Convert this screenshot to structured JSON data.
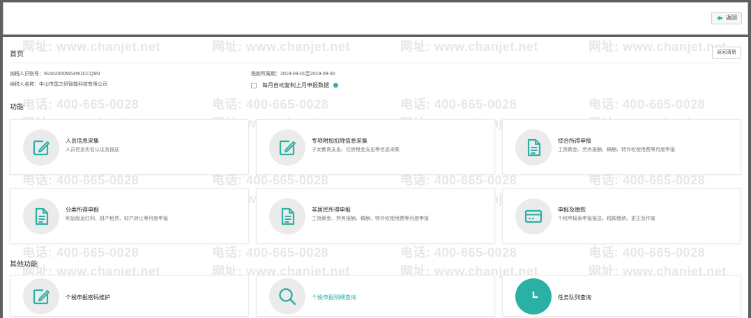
{
  "topbar": {
    "back_label": "返回"
  },
  "watermark": {
    "phone": "电话: 400-665-0028",
    "site": "网址: www.chanjet.net"
  },
  "page": {
    "title": "首页",
    "clear_button": "返回清册",
    "taxpayer_id_label": "纳税人识别号：",
    "taxpayer_id": "91442000MA4WJCCQ9N",
    "taxpayer_name_label": "纳税人名称：",
    "taxpayer_name": "中山市国之研智能科技有限公司",
    "period_label": "税款所属期：",
    "period": "2019-09-01至2019-09-30",
    "auto_copy_label": "每月自动复制上月申报数据"
  },
  "sections": {
    "functions": "功能",
    "other_functions": "其他功能"
  },
  "functions": [
    {
      "title": "人员信息采集",
      "desc": "人员信息实名认证及报送",
      "icon": "edit-icon"
    },
    {
      "title": "专项附加扣除信息采集",
      "desc": "子女教育支出、住房租金支出等信息采集",
      "icon": "edit-icon"
    },
    {
      "title": "综合所得申报",
      "desc": "工资薪金、劳务报酬、稿酬、特许权使用费等月度申报",
      "icon": "document-icon"
    },
    {
      "title": "分类所得申报",
      "desc": "利息股息红利、财产租赁、财产转让等月度申报",
      "icon": "document-icon"
    },
    {
      "title": "非居民所得申报",
      "desc": "工资薪金、劳务报酬、稿酬、特许权使用费等月度申报",
      "icon": "document-icon"
    },
    {
      "title": "申报及缴款",
      "desc": "个税申报表申报报送、税款缴纳、更正及作废",
      "icon": "card-icon"
    }
  ],
  "other_functions": [
    {
      "title": "个税申报密码维护",
      "icon": "edit-icon"
    },
    {
      "title": "个税申报明细查询",
      "icon": "search-icon"
    },
    {
      "title": "任务队列查询",
      "icon": "clock-icon"
    }
  ],
  "colors": {
    "accent": "#2bb0a6",
    "icon_bg": "#ebebeb"
  }
}
